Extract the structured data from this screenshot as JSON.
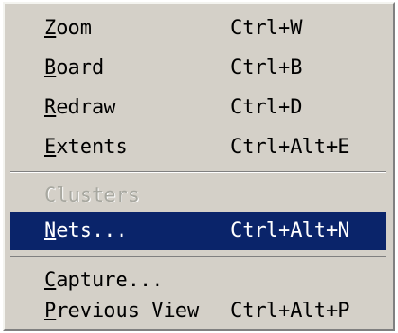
{
  "menu": {
    "items": [
      {
        "mnemonic": "Z",
        "rest": "oom",
        "shortcut": "Ctrl+W"
      },
      {
        "mnemonic": "B",
        "rest": "oard",
        "shortcut": "Ctrl+B"
      },
      {
        "mnemonic": "R",
        "rest": "edraw",
        "shortcut": "Ctrl+D"
      },
      {
        "mnemonic": "E",
        "rest": "xtents",
        "shortcut": "Ctrl+Alt+E"
      },
      {
        "mnemonic": "",
        "rest": "Clusters",
        "shortcut": ""
      },
      {
        "mnemonic": "N",
        "rest": "ets...",
        "shortcut": "Ctrl+Alt+N"
      },
      {
        "mnemonic": "C",
        "rest": "apture...",
        "shortcut": ""
      },
      {
        "mnemonic": "P",
        "rest": "revious View",
        "shortcut": "Ctrl+Alt+P"
      }
    ]
  },
  "colors": {
    "menu_background": "#d4d0c8",
    "selection_background": "#0a246a",
    "selection_text": "#ffffff",
    "disabled_text": "#a8a8a0"
  }
}
